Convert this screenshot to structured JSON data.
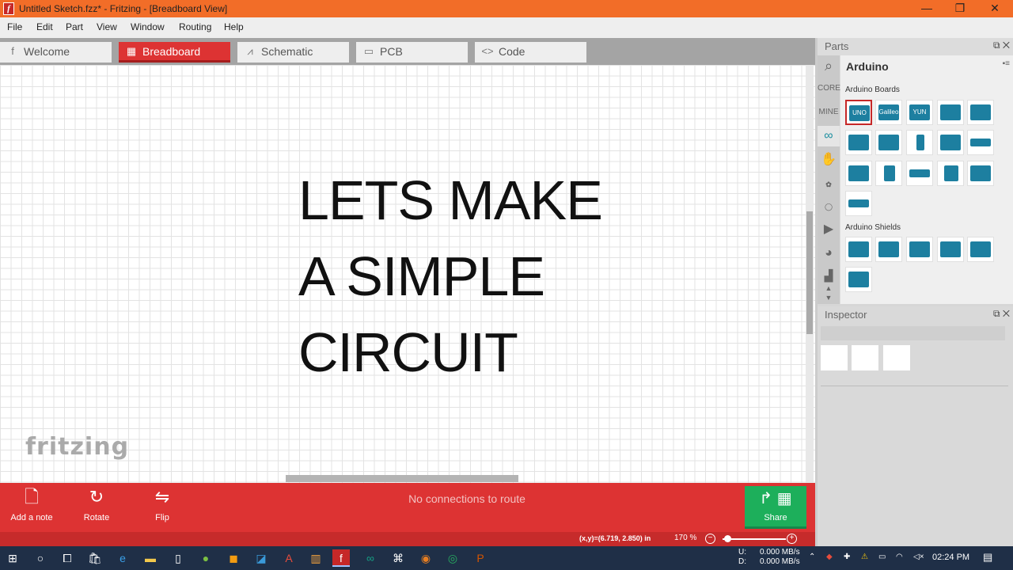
{
  "window": {
    "title": "Untitled Sketch.fzz* - Fritzing - [Breadboard View]",
    "app_icon": "f",
    "minimize": "—",
    "restore": "❐",
    "close": "✕"
  },
  "menu": [
    "File",
    "Edit",
    "Part",
    "View",
    "Window",
    "Routing",
    "Help"
  ],
  "tabs": [
    {
      "label": "Welcome",
      "icon": "f"
    },
    {
      "label": "Breadboard",
      "icon": "▦"
    },
    {
      "label": "Schematic",
      "icon": "⩘"
    },
    {
      "label": "PCB",
      "icon": "▭"
    },
    {
      "label": "Code",
      "icon": "<>"
    }
  ],
  "canvas": {
    "lines": [
      "LETS MAKE",
      "A SIMPLE",
      "CIRCUIT"
    ],
    "logo": "fritzing"
  },
  "toolbar": {
    "add_note": "Add a note",
    "rotate": "Rotate",
    "flip": "Flip",
    "status": "No connections to route",
    "share": "Share"
  },
  "statusbar": {
    "coords": "(x,y)=(6.719, 2.850) in",
    "zoom": "170 %",
    "zoom_out": "−",
    "zoom_in": "+"
  },
  "parts": {
    "panel_title": "Parts",
    "bin_title": "Arduino",
    "bins": [
      "CORE",
      "MINE"
    ],
    "boards_label": "Arduino Boards",
    "shields_label": "Arduino Shields",
    "board_labels": [
      "UNO",
      "Galileo",
      "YUN"
    ]
  },
  "inspector": {
    "title": "Inspector"
  },
  "taskbar": {
    "net_u": "U:",
    "net_u_val": "0.000 MB/s",
    "net_d": "D:",
    "net_d_val": "0.000 MB/s",
    "clock": "02:24 PM"
  },
  "colors": {
    "accent": "#dd3333",
    "title_bar": "#f26d28",
    "share": "#1daf5b",
    "board": "#1d7fa0"
  }
}
